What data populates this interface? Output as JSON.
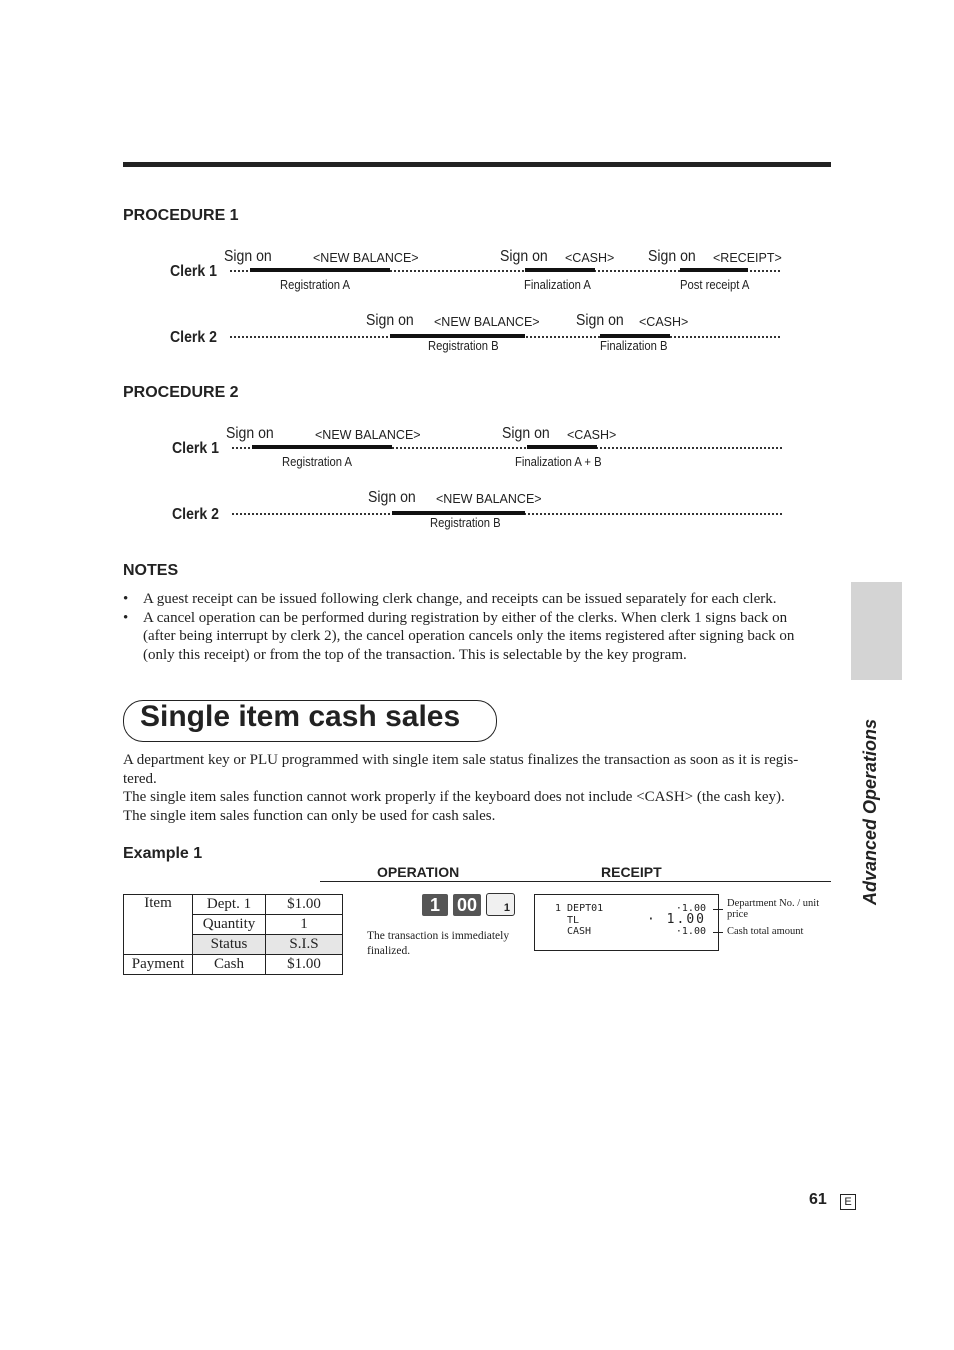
{
  "procedure1": {
    "heading": "PROCEDURE 1",
    "clerk1": {
      "label": "Clerk 1",
      "segments": [
        {
          "sign_on": "Sign on",
          "key": "<NEW BALANCE>",
          "caption": "Registration A"
        },
        {
          "sign_on": "Sign on",
          "key": "<CASH>",
          "caption": "Finalization A"
        },
        {
          "sign_on": "Sign on",
          "key": "<RECEIPT>",
          "caption": "Post receipt A"
        }
      ]
    },
    "clerk2": {
      "label": "Clerk 2",
      "segments": [
        {
          "sign_on": "Sign on",
          "key": "<NEW BALANCE>",
          "caption": "Registration B"
        },
        {
          "sign_on": "Sign on",
          "key": "<CASH>",
          "caption": "Finalization B"
        }
      ]
    }
  },
  "procedure2": {
    "heading": "PROCEDURE 2",
    "clerk1": {
      "label": "Clerk 1",
      "segments": [
        {
          "sign_on": "Sign on",
          "key": "<NEW BALANCE>",
          "caption": "Registration A"
        },
        {
          "sign_on": "Sign on",
          "key": "<CASH>",
          "caption": "Finalization A + B"
        }
      ]
    },
    "clerk2": {
      "label": "Clerk 2",
      "segments": [
        {
          "sign_on": "Sign on",
          "key": "<NEW BALANCE>",
          "caption": "Registration B"
        }
      ]
    }
  },
  "notes": {
    "heading": "NOTES",
    "bullet": "•",
    "items": [
      "A guest receipt can be issued following clerk change, and receipts can be issued separately for each clerk.",
      "A cancel operation can be performed during registration by either of the clerks. When clerk 1 signs back on (after being interrupt by clerk 2), the cancel operation cancels only the items registered after signing back on (only this receipt) or from the top of the transaction. This is selectable by the key program."
    ]
  },
  "section": {
    "title": "Single item cash sales",
    "paragraphs": [
      "A department key or PLU programmed with single item sale status finalizes the transaction as soon as it is regis-tered.",
      "The single item sales function cannot work properly if the keyboard does not include <CASH> (the cash key).",
      "The single item sales function can only be used for cash sales."
    ]
  },
  "example": {
    "heading": "Example 1",
    "operation_label": "OPERATION",
    "receipt_label": "RECEIPT",
    "table": {
      "item": "Item",
      "dept": "Dept. 1",
      "dept_price": "$1.00",
      "quantity_label": "Quantity",
      "quantity": "1",
      "status_label": "Status",
      "status": "S.I.S",
      "payment": "Payment",
      "payment_type": "Cash",
      "payment_amount": "$1.00"
    },
    "keys": [
      "1",
      "00",
      "1"
    ],
    "operation_note": "The transaction is immediately finalized.",
    "receipt": {
      "line1_left": "1 DEPT01",
      "line1_right": "·1.00",
      "line2_left": "TL",
      "line2_right": "· 1.00",
      "line3_left": "CASH",
      "line3_right": "·1.00"
    },
    "annotations": [
      "Department No. / unit price",
      "Cash total amount"
    ]
  },
  "sidebar": {
    "label": "Advanced Operations"
  },
  "footer": {
    "page_number": "61",
    "language": "E"
  }
}
